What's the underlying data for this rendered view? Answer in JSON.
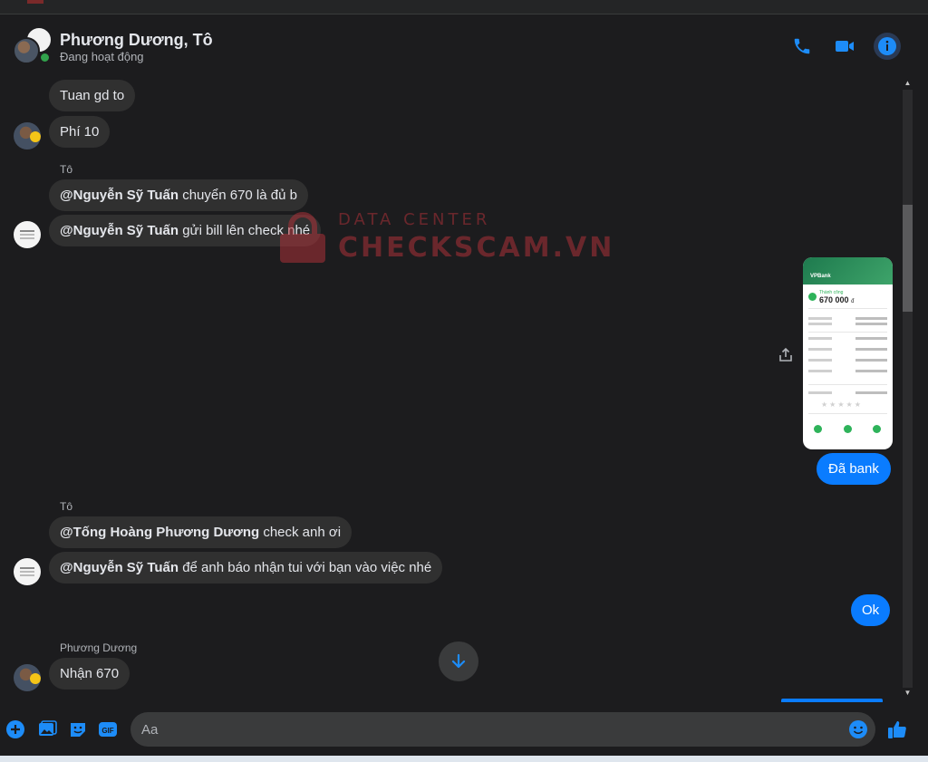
{
  "header": {
    "name": "Phương Dương, Tô",
    "status": "Đang hoạt động",
    "icons": [
      "phone-icon",
      "video-icon",
      "info-icon"
    ]
  },
  "messages": {
    "m1": "Tuan gd to",
    "m2": "Phí 10",
    "sender_to_1": "Tô",
    "m3_mention": "@Nguyễn Sỹ Tuấn",
    "m3_text": " chuyển 670 là đủ b",
    "m4_mention": "@Nguyễn Sỹ Tuấn",
    "m4_text": " gửi bill lên check nhé",
    "out1": "Đã bank",
    "sender_to_2": "Tô",
    "m5_mention": "@Tống Hoàng Phương Dương",
    "m5_text": " check anh ơi",
    "m6_mention": "@Nguyễn Sỹ Tuấn",
    "m6_text": " để anh báo nhận tui với bạn vào việc nhé",
    "out2": "Ok",
    "sender_pd": "Phương Dương",
    "m7": "Nhận 670"
  },
  "receipt": {
    "brand": "VPBank",
    "status": "Thành công",
    "amount": "670 000",
    "currency": "đ"
  },
  "watermark": {
    "line1": "DATA CENTER",
    "line2": "CHECKSCAM.VN"
  },
  "composer": {
    "placeholder": "Aa",
    "icons": [
      "plus-icon",
      "image-icon",
      "sticker-icon",
      "gif-icon",
      "emoji-icon",
      "like-icon"
    ]
  },
  "colors": {
    "accent": "#0a7cff",
    "bubble_in": "#303030",
    "background": "#1c1c1e",
    "online": "#31a24c"
  }
}
